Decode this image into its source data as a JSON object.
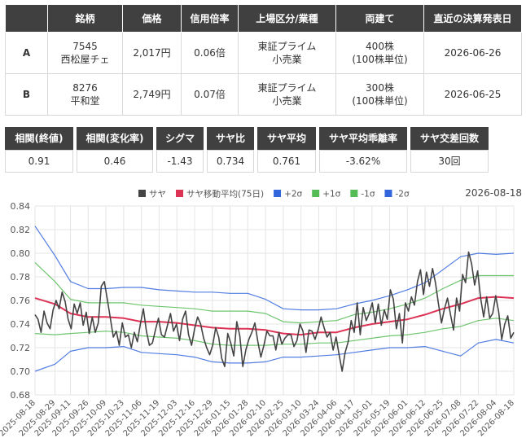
{
  "pair_table": {
    "headers": [
      "",
      "銘柄",
      "価格",
      "信用倍率",
      "上場区分/業種",
      "両建て",
      "直近の決算発表日"
    ],
    "rows": [
      {
        "label": "A",
        "code": "7545",
        "name": "西松屋チェ",
        "price": "2,017円",
        "margin_ratio": "0.06倍",
        "market": "東証プライム",
        "sector": "小売業",
        "hedge": "400株",
        "hedge_unit": "(100株単位)",
        "earnings_date": "2026-06-26"
      },
      {
        "label": "B",
        "code": "8276",
        "name": "平和堂",
        "price": "2,749円",
        "margin_ratio": "0.07倍",
        "market": "東証プライム",
        "sector": "小売業",
        "hedge": "300株",
        "hedge_unit": "(100株単位)",
        "earnings_date": "2026-06-25"
      }
    ]
  },
  "stats": [
    {
      "label": "相関(終値)",
      "value": "0.91"
    },
    {
      "label": "相関(変化率)",
      "value": "0.46"
    },
    {
      "label": "シグマ",
      "value": "-1.43"
    },
    {
      "label": "サヤ比",
      "value": "0.734"
    },
    {
      "label": "サヤ平均",
      "value": "0.761"
    },
    {
      "label": "サヤ平均乖離率",
      "value": "-3.62%"
    },
    {
      "label": "サヤ交差回数",
      "value": "30回"
    }
  ],
  "chart_data": {
    "type": "line",
    "date_label": "2026-08-18",
    "ylim": [
      0.68,
      0.84
    ],
    "y_ticks": [
      "0.68",
      "0.70",
      "0.72",
      "0.74",
      "0.76",
      "0.78",
      "0.80",
      "0.82",
      "0.84"
    ],
    "x_ticks": [
      "2025-08-18",
      "2025-08-29",
      "2025-09-11",
      "2025-09-26",
      "2025-10-09",
      "2025-10-23",
      "2025-11-06",
      "2025-11-19",
      "2025-12-03",
      "2025-12-16",
      "2025-12-29",
      "2026-01-15",
      "2026-01-28",
      "2026-02-10",
      "2026-02-25",
      "2026-03-10",
      "2026-03-24",
      "2026-04-06",
      "2026-04-17",
      "2026-05-01",
      "2026-05-19",
      "2026-06-01",
      "2026-06-12",
      "2026-06-25",
      "2026-07-08",
      "2026-07-22",
      "2026-08-04",
      "2026-08-18"
    ],
    "grid": true,
    "legend_position": "top",
    "x_positions": [
      0,
      4.5,
      8,
      12,
      16,
      20,
      24,
      28,
      32,
      36,
      40,
      44,
      48,
      52,
      56,
      60,
      64,
      68,
      72,
      76,
      80,
      84,
      88,
      92,
      96,
      100,
      104,
      108
    ],
    "band_keys": [
      0,
      4.5,
      8,
      12,
      16,
      20,
      24,
      28,
      32,
      36,
      40,
      44,
      48,
      52,
      56,
      60,
      64,
      68,
      72,
      76,
      80,
      84,
      88,
      92,
      96,
      100,
      104,
      108
    ],
    "series": [
      {
        "name": "サヤ",
        "color": "#444444",
        "values": [
          0.748,
          0.744,
          0.733,
          0.751,
          0.741,
          0.736,
          0.752,
          0.76,
          0.753,
          0.767,
          0.759,
          0.744,
          0.736,
          0.757,
          0.749,
          0.758,
          0.739,
          0.75,
          0.732,
          0.746,
          0.733,
          0.741,
          0.772,
          0.776,
          0.761,
          0.745,
          0.729,
          0.734,
          0.722,
          0.741,
          0.729,
          0.731,
          0.72,
          0.733,
          0.725,
          0.74,
          0.753,
          0.734,
          0.722,
          0.724,
          0.735,
          0.745,
          0.731,
          0.729,
          0.739,
          0.749,
          0.734,
          0.74,
          0.726,
          0.744,
          0.751,
          0.731,
          0.722,
          0.736,
          0.746,
          0.74,
          0.728,
          0.72,
          0.714,
          0.722,
          0.737,
          0.729,
          0.711,
          0.704,
          0.732,
          0.724,
          0.713,
          0.742,
          0.73,
          0.704,
          0.718,
          0.727,
          0.733,
          0.741,
          0.725,
          0.712,
          0.722,
          0.734,
          0.73,
          0.73,
          0.718,
          0.733,
          0.723,
          0.728,
          0.731,
          0.731,
          0.721,
          0.726,
          0.74,
          0.734,
          0.716,
          0.735,
          0.734,
          0.727,
          0.735,
          0.746,
          0.737,
          0.729,
          0.733,
          0.718,
          0.729,
          0.714,
          0.7,
          0.716,
          0.725,
          0.743,
          0.733,
          0.758,
          0.731,
          0.754,
          0.743,
          0.749,
          0.758,
          0.741,
          0.757,
          0.739,
          0.752,
          0.744,
          0.769,
          0.761,
          0.736,
          0.749,
          0.724,
          0.758,
          0.751,
          0.763,
          0.756,
          0.776,
          0.786,
          0.765,
          0.784,
          0.772,
          0.787,
          0.775,
          0.757,
          0.741,
          0.753,
          0.762,
          0.748,
          0.735,
          0.762,
          0.751,
          0.782,
          0.775,
          0.801,
          0.791,
          0.773,
          0.785,
          0.762,
          0.746,
          0.763,
          0.745,
          0.749,
          0.764,
          0.75,
          0.727,
          0.74,
          0.747,
          0.728,
          0.733
        ]
      },
      {
        "name": "サヤ移動平均(75日)",
        "color": "#dd3355",
        "band": [
          0.762,
          0.757,
          0.749,
          0.746,
          0.746,
          0.745,
          0.742,
          0.742,
          0.741,
          0.739,
          0.737,
          0.736,
          0.736,
          0.735,
          0.732,
          0.731,
          0.733,
          0.733,
          0.737,
          0.74,
          0.742,
          0.744,
          0.748,
          0.753,
          0.757,
          0.762,
          0.763,
          0.762
        ]
      },
      {
        "name": "+2σ",
        "color": "#3366dd",
        "band": [
          0.823,
          0.798,
          0.776,
          0.77,
          0.77,
          0.771,
          0.771,
          0.769,
          0.768,
          0.767,
          0.767,
          0.766,
          0.766,
          0.761,
          0.753,
          0.752,
          0.752,
          0.753,
          0.757,
          0.76,
          0.764,
          0.769,
          0.775,
          0.786,
          0.797,
          0.8,
          0.799,
          0.8
        ]
      },
      {
        "name": "+1σ",
        "color": "#55bb55",
        "band": [
          0.792,
          0.776,
          0.761,
          0.758,
          0.758,
          0.758,
          0.756,
          0.755,
          0.754,
          0.753,
          0.751,
          0.751,
          0.751,
          0.749,
          0.742,
          0.741,
          0.742,
          0.743,
          0.748,
          0.75,
          0.753,
          0.757,
          0.762,
          0.77,
          0.777,
          0.781,
          0.781,
          0.781
        ]
      },
      {
        "name": "-1σ",
        "color": "#55bb55",
        "band": [
          0.732,
          0.731,
          0.732,
          0.733,
          0.734,
          0.733,
          0.73,
          0.729,
          0.728,
          0.726,
          0.723,
          0.722,
          0.722,
          0.722,
          0.723,
          0.723,
          0.724,
          0.724,
          0.726,
          0.728,
          0.73,
          0.731,
          0.733,
          0.736,
          0.738,
          0.743,
          0.745,
          0.743
        ]
      },
      {
        "name": "-2σ",
        "color": "#3366dd",
        "band": [
          0.7,
          0.706,
          0.717,
          0.72,
          0.72,
          0.721,
          0.716,
          0.715,
          0.714,
          0.712,
          0.708,
          0.707,
          0.707,
          0.708,
          0.712,
          0.712,
          0.713,
          0.714,
          0.716,
          0.718,
          0.72,
          0.72,
          0.721,
          0.717,
          0.713,
          0.724,
          0.727,
          0.724
        ]
      }
    ]
  }
}
